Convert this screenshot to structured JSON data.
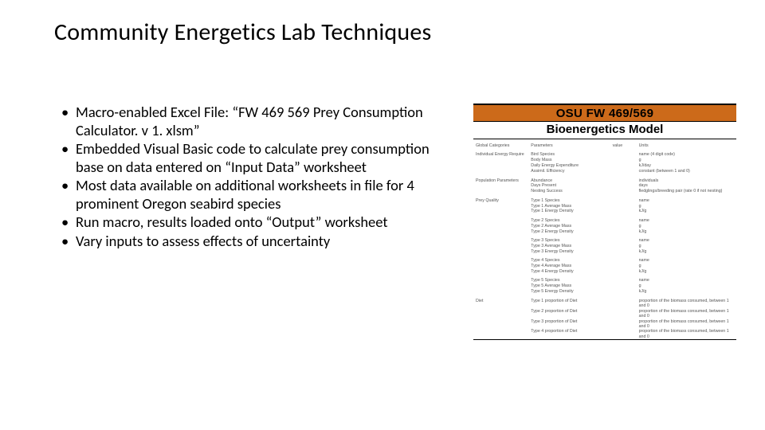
{
  "title": "Community Energetics Lab Techniques",
  "bullets": [
    "Macro-enabled Excel File: “FW 469 569 Prey Consumption Calculator. v 1. xlsm”",
    "Embedded Visual Basic code to calculate prey consumption base on data entered on “Input Data” worksheet",
    "Most data available on additional worksheets in file for 4 prominent Oregon seabird species",
    "Run macro, results loaded onto “Output” worksheet",
    "Vary inputs to assess effects of uncertainty"
  ],
  "figure": {
    "banner": "OSU FW 469/569",
    "subtitle": "Bioenergetics Model",
    "rows": [
      {
        "c1": "Global Categories",
        "c2": "Parameters",
        "c3": "value",
        "c4": "Units",
        "gap": true
      },
      {
        "c1": "Individual Energy Require",
        "c2": "Bird Species",
        "c3": "",
        "c4": "name (4 digit code)",
        "gap": true
      },
      {
        "c1": "",
        "c2": "Body Mass",
        "c3": "",
        "c4": "g"
      },
      {
        "c1": "",
        "c2": "Daily Energy Expenditure",
        "c3": "",
        "c4": "kJ/day"
      },
      {
        "c1": "",
        "c2": "Assimil. Efficiency",
        "c3": "",
        "c4": "constant (between 1 and 0)"
      },
      {
        "c1": "Population Parameters",
        "c2": "Abundance",
        "c3": "",
        "c4": "individuals",
        "gap": true
      },
      {
        "c1": "",
        "c2": "Days Present",
        "c3": "",
        "c4": "days"
      },
      {
        "c1": "",
        "c2": "Nesting Success",
        "c3": "",
        "c4": "fledglings/breeding pair (rate 0 if not nesting)"
      },
      {
        "c1": "Prey Quality",
        "c2": "Type 1 Species",
        "c3": "",
        "c4": "name",
        "gap": true
      },
      {
        "c1": "",
        "c2": "Type 1 Average Mass",
        "c3": "",
        "c4": "g"
      },
      {
        "c1": "",
        "c2": "Type 1 Energy Density",
        "c3": "",
        "c4": "kJ/g"
      },
      {
        "c1": "",
        "c2": "Type 2 Species",
        "c3": "",
        "c4": "name",
        "gap": true
      },
      {
        "c1": "",
        "c2": "Type 2 Average Mass",
        "c3": "",
        "c4": "g"
      },
      {
        "c1": "",
        "c2": "Type 2 Energy Density",
        "c3": "",
        "c4": "kJ/g"
      },
      {
        "c1": "",
        "c2": "Type 3 Species",
        "c3": "",
        "c4": "name",
        "gap": true
      },
      {
        "c1": "",
        "c2": "Type 3 Average Mass",
        "c3": "",
        "c4": "g"
      },
      {
        "c1": "",
        "c2": "Type 3 Energy Density",
        "c3": "",
        "c4": "kJ/g"
      },
      {
        "c1": "",
        "c2": "Type 4 Species",
        "c3": "",
        "c4": "name",
        "gap": true
      },
      {
        "c1": "",
        "c2": "Type 4 Average Mass",
        "c3": "",
        "c4": "g"
      },
      {
        "c1": "",
        "c2": "Type 4 Energy Density",
        "c3": "",
        "c4": "kJ/g"
      },
      {
        "c1": "",
        "c2": "Type 5 Species",
        "c3": "",
        "c4": "name",
        "gap": true
      },
      {
        "c1": "",
        "c2": "Type 5 Average Mass",
        "c3": "",
        "c4": "g"
      },
      {
        "c1": "",
        "c2": "Type 5 Energy Density",
        "c3": "",
        "c4": "kJ/g"
      },
      {
        "c1": "Diet",
        "c2": "Type 1 proportion of Diet",
        "c3": "",
        "c4": "proportion of the biomass consumed, between 1 and 0",
        "gap": true
      },
      {
        "c1": "",
        "c2": "Type 2 proportion of Diet",
        "c3": "",
        "c4": "proportion of the biomass consumed, between 1 and 0"
      },
      {
        "c1": "",
        "c2": "Type 3 proportion of Diet",
        "c3": "",
        "c4": "proportion of the biomass consumed, between 1 and 0"
      },
      {
        "c1": "",
        "c2": "Type 4 proportion of Diet",
        "c3": "",
        "c4": "proportion of the biomass consumed, between 1 and 0"
      }
    ]
  }
}
